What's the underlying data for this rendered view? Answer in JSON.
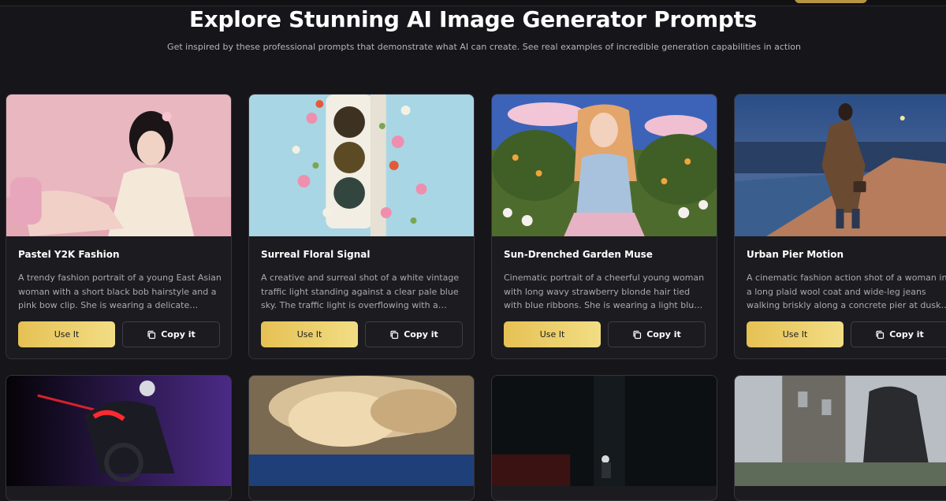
{
  "header": {
    "title": "Explore Stunning AI Image Generator Prompts",
    "subtitle": "Get inspired by these professional prompts that demonstrate what AI can create. See real examples of incredible generation capabilities in action"
  },
  "colors": {
    "accent": "#e6c154",
    "background": "#15151a",
    "card": "#1b1b20"
  },
  "cards": [
    {
      "title": "Pastel Y2K Fashion",
      "description": "A trendy fashion portrait of a young East Asian woman with a short black bob hairstyle and a pink bow clip. She is wearing a delicate cream-colore…",
      "use_label": "Use It",
      "copy_label": "Copy it"
    },
    {
      "title": "Surreal Floral Signal",
      "description": "A creative and surreal shot of a white vintage traffic light standing against a clear pale blue sky. The traffic light is overflowing with a lush…",
      "use_label": "Use It",
      "copy_label": "Copy it"
    },
    {
      "title": "Sun-Drenched Garden Muse",
      "description": "Cinematic portrait of a cheerful young woman with long wavy strawberry blonde hair tied with blue ribbons. She is wearing a light blue and pink long…",
      "use_label": "Use It",
      "copy_label": "Copy it"
    },
    {
      "title": "Urban Pier Motion",
      "description": "A cinematic fashion action shot of a woman in a long plaid wool coat and wide-leg jeans walking briskly along a concrete pier at dusk. She carries …",
      "use_label": "Use It",
      "copy_label": "Copy it"
    }
  ]
}
